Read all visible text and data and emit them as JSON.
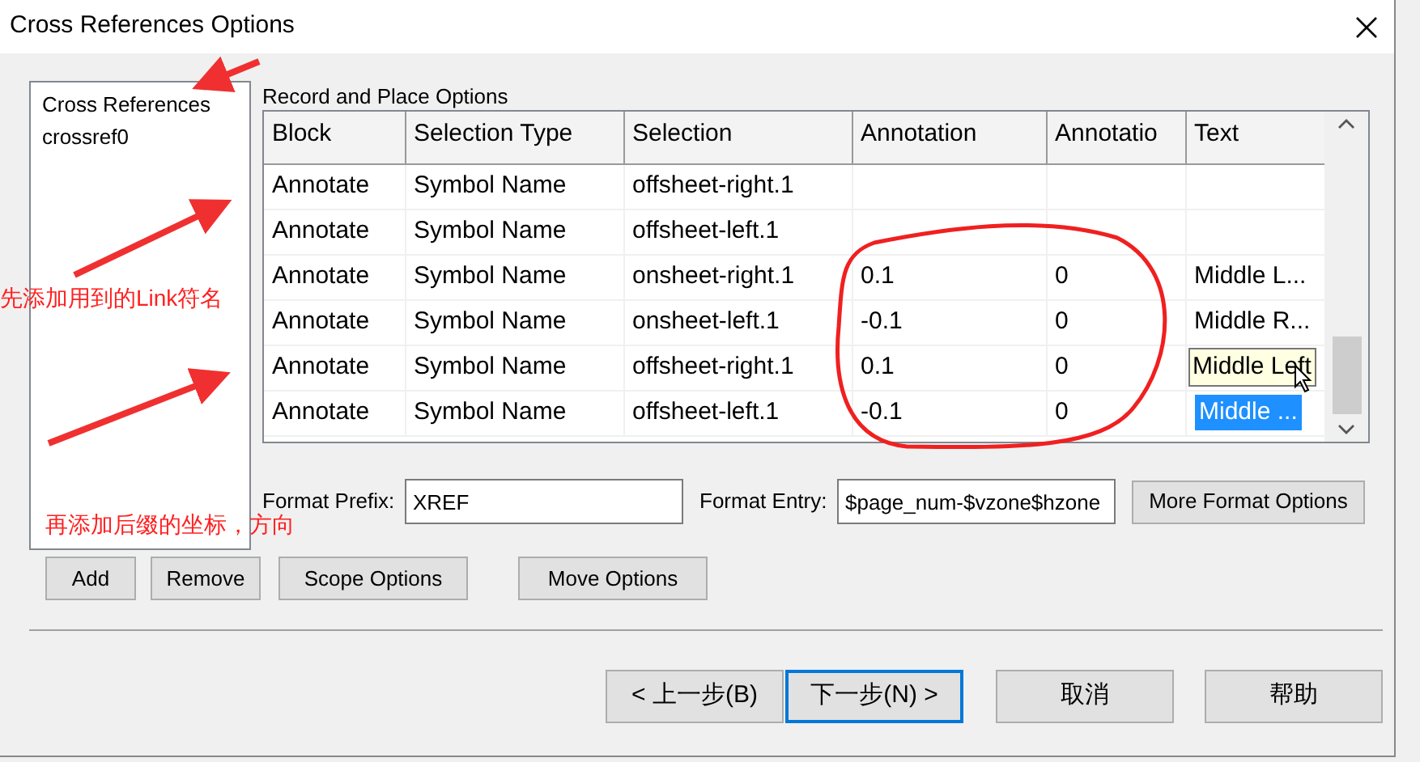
{
  "window": {
    "title": "Cross References Options"
  },
  "sidebar": {
    "items": [
      {
        "label": "Cross References",
        "selected": false
      },
      {
        "label": "crossref0",
        "selected": false
      }
    ]
  },
  "record_options": {
    "label": "Record and Place Options",
    "columns": [
      "Block",
      "Selection Type",
      "Selection",
      "Annotation",
      "Annotatio",
      "Text"
    ],
    "rows": [
      {
        "cells": [
          "Annotate",
          "Symbol Name",
          "offsheet-right.1",
          "",
          "",
          ""
        ],
        "selected": false,
        "hovered": false
      },
      {
        "cells": [
          "Annotate",
          "Symbol Name",
          "offsheet-left.1",
          "",
          "",
          ""
        ],
        "selected": false,
        "hovered": false
      },
      {
        "cells": [
          "Annotate",
          "Symbol Name",
          "onsheet-right.1",
          "0.1",
          "0",
          "Middle L..."
        ],
        "selected": false,
        "hovered": false
      },
      {
        "cells": [
          "Annotate",
          "Symbol Name",
          "onsheet-left.1",
          "-0.1",
          "0",
          "Middle R..."
        ],
        "selected": false,
        "hovered": false
      },
      {
        "cells": [
          "Annotate",
          "Symbol Name",
          "offsheet-right.1",
          "0.1",
          "0",
          "Middle Left"
        ],
        "selected": false,
        "hovered": true
      },
      {
        "cells": [
          "Annotate",
          "Symbol Name",
          "offsheet-left.1",
          "-0.1",
          "0",
          "Middle ..."
        ],
        "selected": true,
        "hovered": false
      }
    ]
  },
  "format": {
    "prefix_label": "Format Prefix:",
    "prefix_value": "XREF",
    "entry_label": "Format Entry:",
    "entry_value": "$page_num-$vzone$hzone",
    "more_button": "More Format Options"
  },
  "action_buttons": [
    "Add",
    "Remove",
    "Scope Options",
    "Move Options"
  ],
  "footer_buttons": [
    {
      "label": "< 上一步(B)",
      "default": false
    },
    {
      "label": "下一步(N) >",
      "default": true
    },
    {
      "label": "取消",
      "default": false
    },
    {
      "label": "帮助",
      "default": false
    }
  ],
  "annotations": {
    "notes": [
      "先添加用到的Link符名",
      "再添加后缀的坐标，方向"
    ]
  }
}
